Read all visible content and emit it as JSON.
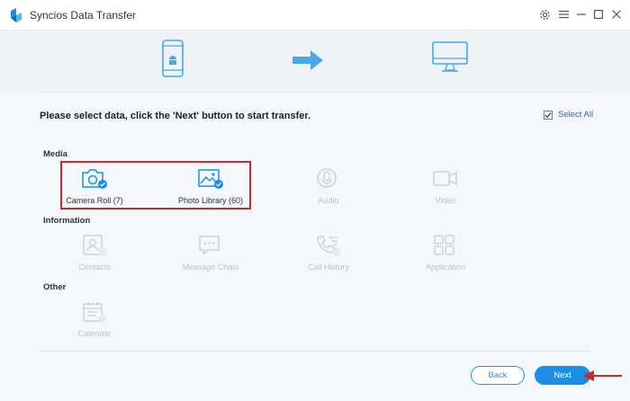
{
  "titlebar": {
    "title": "Syncios Data Transfer",
    "icons": [
      "app-logo-icon",
      "settings-icon",
      "menu-icon",
      "minimize-icon",
      "maximize-icon",
      "close-icon"
    ]
  },
  "header": {
    "icons": [
      "android-phone-icon",
      "transfer-arrow-icon",
      "computer-monitor-icon"
    ]
  },
  "instruction": "Please select data, click the 'Next' button to start transfer.",
  "select_all": {
    "label": "Select All",
    "checked": true
  },
  "sections": {
    "media": {
      "label": "Media",
      "items": [
        {
          "label": "Camera Roll (7)",
          "icon": "camera-icon",
          "selected": true
        },
        {
          "label": "Photo Library (60)",
          "icon": "photo-icon",
          "selected": true
        },
        {
          "label": "Audio",
          "icon": "audio-icon",
          "selected": false
        },
        {
          "label": "Video",
          "icon": "video-icon",
          "selected": false
        }
      ]
    },
    "information": {
      "label": "Information",
      "items": [
        {
          "label": "Contacts",
          "icon": "contacts-icon",
          "selected": false
        },
        {
          "label": "Message Chats",
          "icon": "message-icon",
          "selected": false
        },
        {
          "label": "Call History",
          "icon": "call-history-icon",
          "selected": false
        },
        {
          "label": "Application",
          "icon": "application-icon",
          "selected": false
        }
      ]
    },
    "other": {
      "label": "Other",
      "items": [
        {
          "label": "Calendar",
          "icon": "calendar-icon",
          "selected": false
        }
      ]
    }
  },
  "buttons": {
    "back": "Back",
    "next": "Next"
  },
  "colors": {
    "accent": "#1a8fe3",
    "annotation_red": "#c92a2a",
    "disabled": "#b7c3cf"
  }
}
